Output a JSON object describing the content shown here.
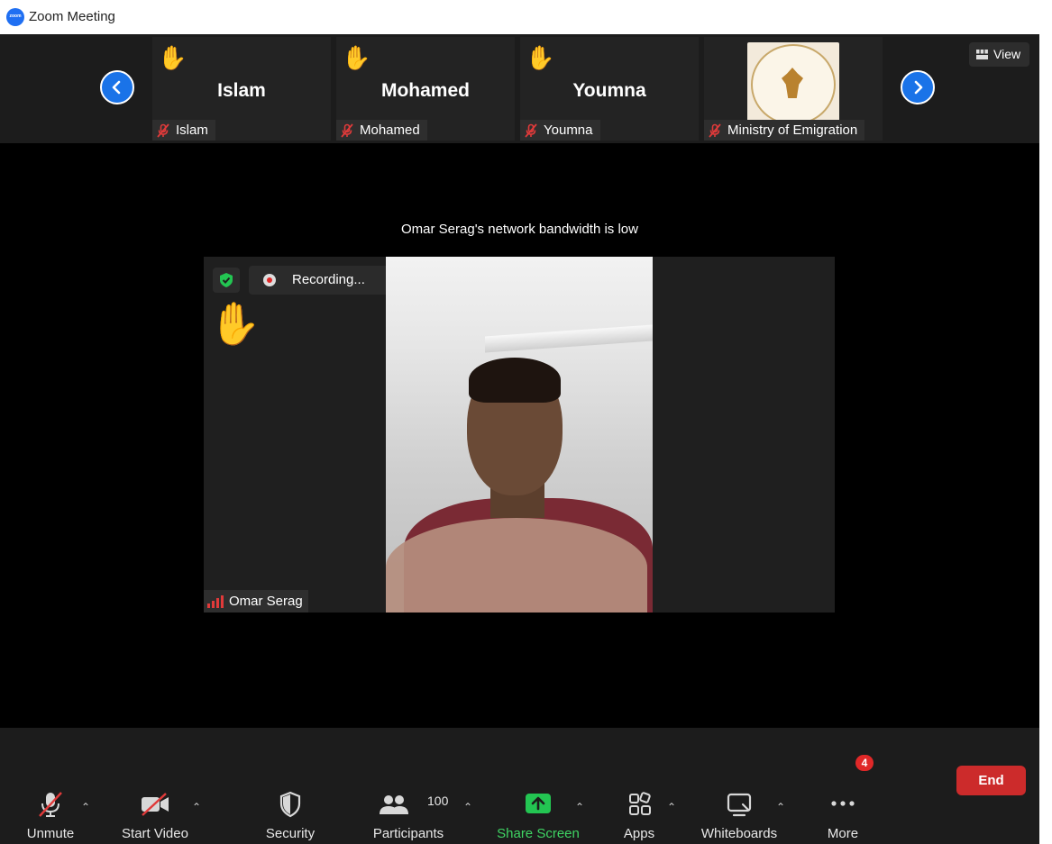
{
  "window": {
    "title": "Zoom Meeting",
    "logo_text": "zoom"
  },
  "gallery": {
    "tiles": [
      {
        "big_name": "Islam",
        "label": "Islam",
        "raised_hand": true
      },
      {
        "big_name": "Mohamed",
        "label": "Mohamed",
        "raised_hand": true
      },
      {
        "big_name": "Youmna",
        "label": "Youmna",
        "raised_hand": true
      },
      {
        "big_name": "",
        "label": "Ministry of Emigration",
        "raised_hand": false
      }
    ],
    "view_label": "View"
  },
  "notice": "Omar Serag's network bandwidth is low",
  "main_video": {
    "recording_label": "Recording...",
    "participant_name": "Omar Serag",
    "raised_hand_glyph": "✋"
  },
  "toolbar": {
    "unmute": "Unmute",
    "start_video": "Start Video",
    "security": "Security",
    "participants": "Participants",
    "participants_count": "100",
    "share_screen": "Share Screen",
    "apps": "Apps",
    "whiteboards": "Whiteboards",
    "more": "More",
    "more_badge": "4",
    "end": "End"
  },
  "colors": {
    "accent_blue": "#1a73e8",
    "share_green": "#3fd463",
    "end_red": "#cc2b2b",
    "hand_yellow": "#f5b400"
  },
  "icons": {
    "nav_prev": "chevron-left-icon",
    "nav_next": "chevron-right-icon",
    "mic": "mic-off-icon",
    "video": "video-off-icon",
    "security": "shield-icon",
    "participants": "people-icon",
    "share": "share-arrow-icon",
    "apps": "apps-icon",
    "whiteboards": "whiteboard-icon",
    "more": "ellipsis-icon"
  },
  "hand_glyph": "✋"
}
